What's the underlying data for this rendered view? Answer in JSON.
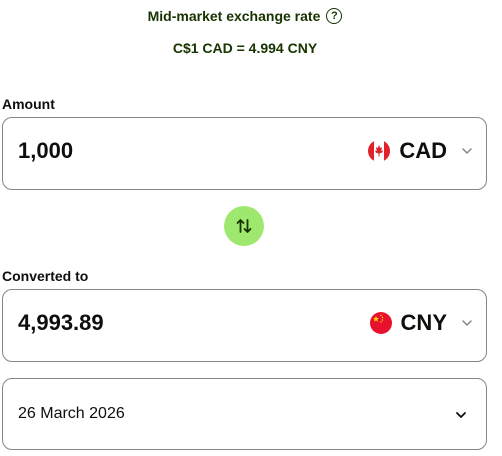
{
  "rate": {
    "label": "Mid-market exchange rate",
    "help_icon": "?",
    "value": "C$1 CAD = 4.994 CNY"
  },
  "amount": {
    "label": "Amount",
    "value": "1,000",
    "currency_code": "CAD",
    "flag_icon": "canada-flag-icon"
  },
  "swap": {
    "icon": "swap-arrows-icon",
    "color": "#9fe870"
  },
  "converted": {
    "label": "Converted to",
    "value": "4,993.89",
    "currency_code": "CNY",
    "flag_icon": "china-flag-icon"
  },
  "date": {
    "value": "26 March 2026"
  },
  "colors": {
    "accent": "#9fe870",
    "heading": "#163300",
    "text": "#0e0f0c",
    "border": "#868685"
  }
}
